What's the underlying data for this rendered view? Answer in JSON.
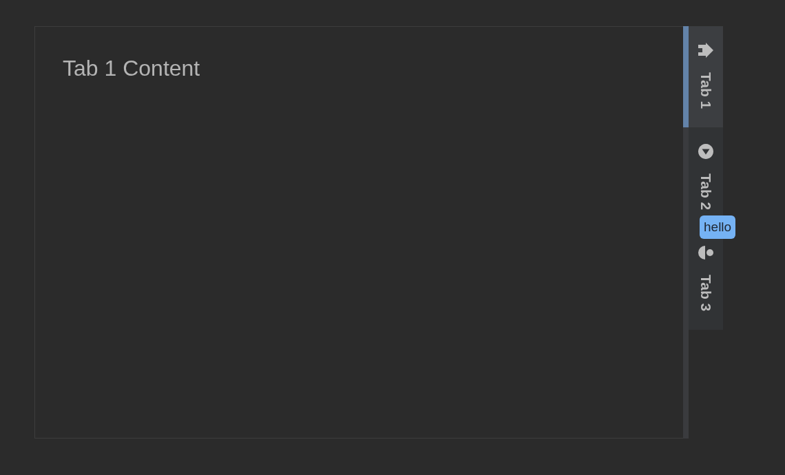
{
  "content": {
    "text": "Tab 1 Content"
  },
  "tabs": [
    {
      "label": "Tab 1",
      "selected": true
    },
    {
      "label": "Tab 2",
      "selected": false,
      "badge": "hello"
    },
    {
      "label": "Tab 3",
      "selected": false
    }
  ]
}
